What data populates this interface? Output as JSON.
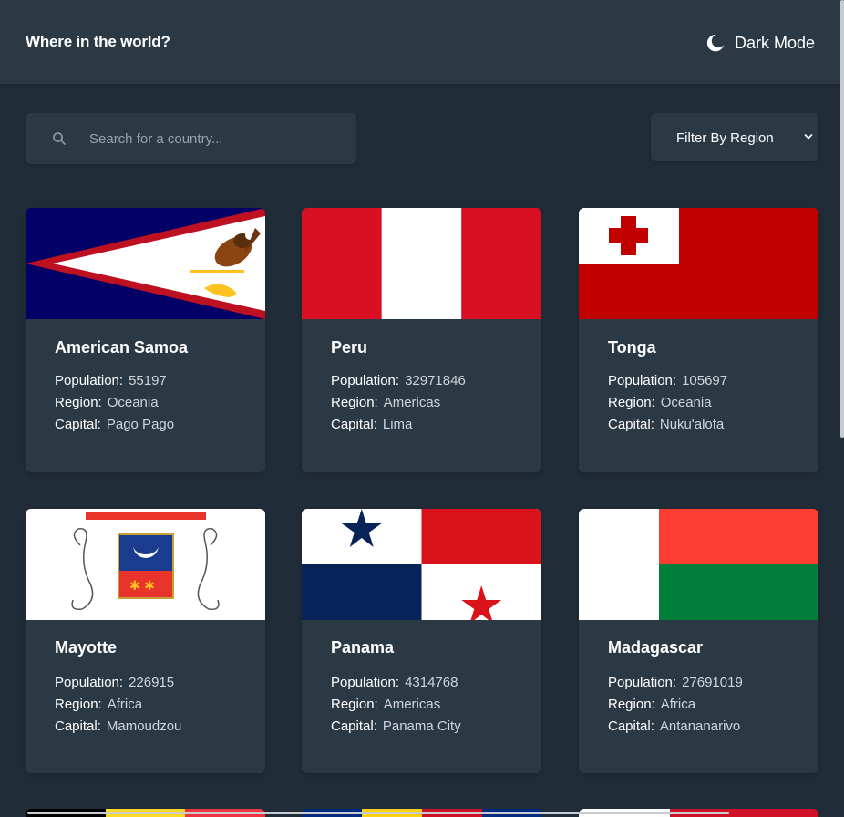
{
  "header": {
    "title": "Where in the world?",
    "theme_toggle": {
      "label": "Dark Mode",
      "icon": "moon-icon"
    }
  },
  "search": {
    "placeholder": "Search for a country...",
    "value": "",
    "icon": "search-icon"
  },
  "filter": {
    "label": "Filter By Region",
    "icon": "chevron-down-icon"
  },
  "labels": {
    "population": "Population:",
    "region": "Region:",
    "capital": "Capital:"
  },
  "countries": [
    {
      "name": "American Samoa",
      "population": "55197",
      "region": "Oceania",
      "capital": "Pago Pago"
    },
    {
      "name": "Peru",
      "population": "32971846",
      "region": "Americas",
      "capital": "Lima"
    },
    {
      "name": "Tonga",
      "population": "105697",
      "region": "Oceania",
      "capital": "Nuku'alofa"
    },
    {
      "name": "Mayotte",
      "population": "226915",
      "region": "Africa",
      "capital": "Mamoudzou"
    },
    {
      "name": "Panama",
      "population": "4314768",
      "region": "Americas",
      "capital": "Panama City"
    },
    {
      "name": "Madagascar",
      "population": "27691019",
      "region": "Africa",
      "capital": "Antananarivo"
    }
  ],
  "colors": {
    "background": "#202c37",
    "elements": "#2b3945",
    "text": "#ffffff"
  }
}
